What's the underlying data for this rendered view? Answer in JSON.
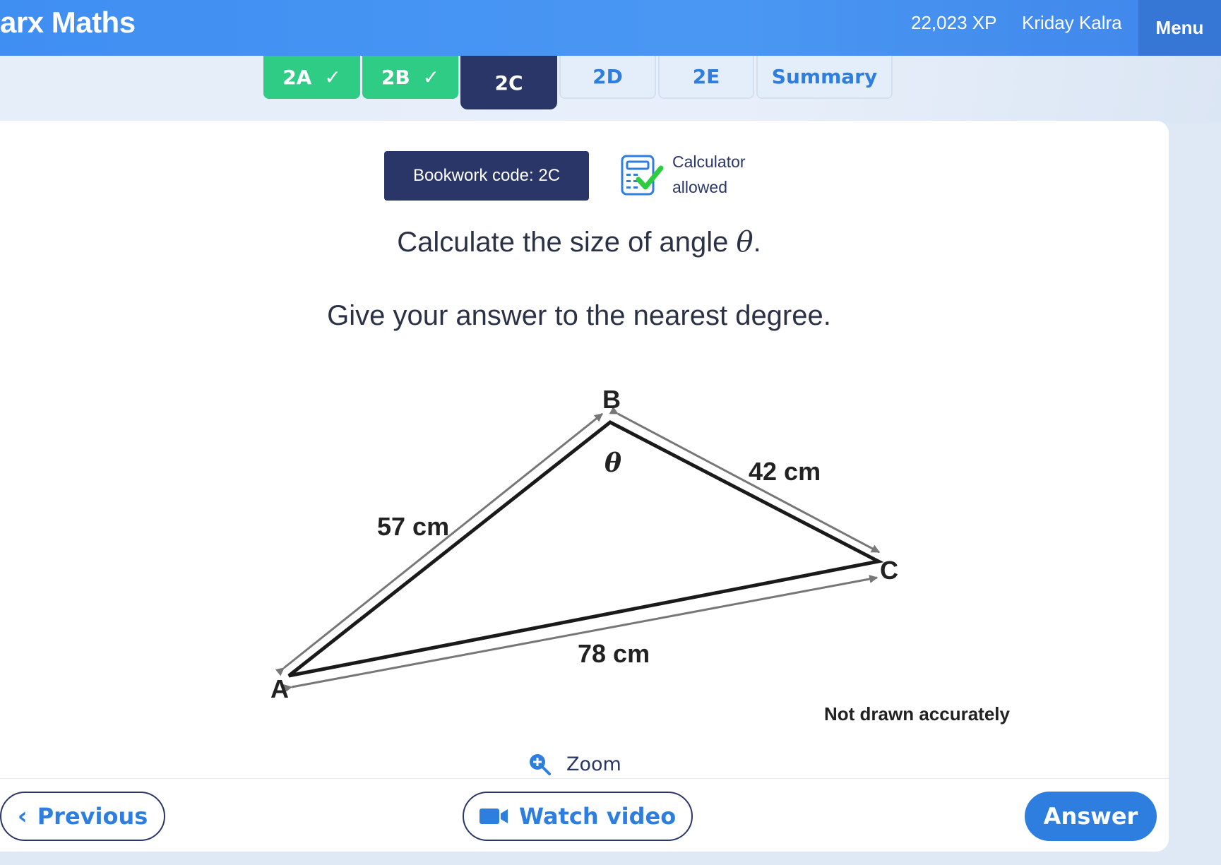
{
  "header": {
    "brand": "arx Maths",
    "xp": "22,023 XP",
    "user": "Kriday Kalra",
    "menu": "Menu"
  },
  "tabs": [
    {
      "label": "2A",
      "state": "done"
    },
    {
      "label": "2B",
      "state": "done"
    },
    {
      "label": "2C",
      "state": "current"
    },
    {
      "label": "2D",
      "state": "todo"
    },
    {
      "label": "2E",
      "state": "todo"
    },
    {
      "label": "Summary",
      "state": "todo"
    }
  ],
  "question": {
    "bookwork": "Bookwork code: 2C",
    "calc_line1": "Calculator",
    "calc_line2": "allowed",
    "prompt_text": "Calculate the size of angle ",
    "prompt_symbol": "θ",
    "prompt_end": ".",
    "instruction": "Give your answer to the nearest degree."
  },
  "diagram": {
    "vertex_a": "A",
    "vertex_b": "B",
    "vertex_c": "C",
    "angle": "θ",
    "side_ab": "57 cm",
    "side_bc": "42 cm",
    "side_ac": "78 cm",
    "note": "Not drawn accurately",
    "colors": {
      "angle_fill": "#1a9ad6",
      "arrow": "#777777"
    }
  },
  "footer": {
    "zoom": "Zoom",
    "previous": "Previous",
    "watch_video": "Watch video",
    "answer": "Answer"
  },
  "colors": {
    "header_blue": "#4a97f3",
    "navy": "#2b3668",
    "green": "#2ecc85",
    "link_blue": "#2e7ee0"
  }
}
